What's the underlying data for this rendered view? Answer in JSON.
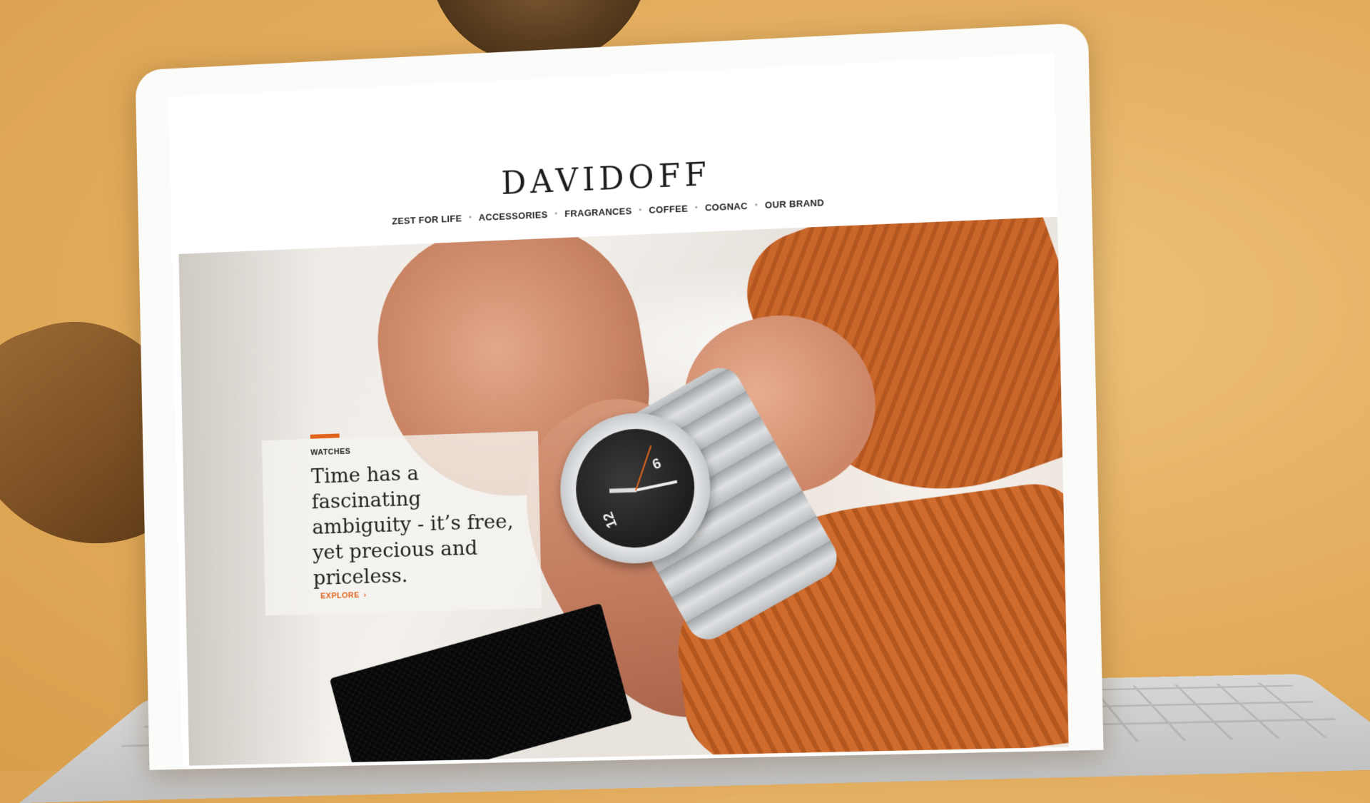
{
  "brand": {
    "logo_text": "DAVIDOFF"
  },
  "nav": {
    "items": [
      {
        "label": "ZEST FOR LIFE"
      },
      {
        "label": "ACCESSORIES"
      },
      {
        "label": "FRAGRANCES"
      },
      {
        "label": "COFFEE"
      },
      {
        "label": "COGNAC"
      },
      {
        "label": "OUR BRAND"
      }
    ],
    "separator": "•"
  },
  "hero": {
    "tag": "WATCHES",
    "headline": "Time has a fascinating ambiguity - it’s free, yet precious and priceless.",
    "cta_label": "EXPLORE",
    "cta_icon": "arrow-right-icon",
    "watch_numerals": [
      "6",
      "12"
    ]
  },
  "colors": {
    "accent": "#e0631e",
    "background": "#e2ac5c",
    "text": "#222222"
  }
}
